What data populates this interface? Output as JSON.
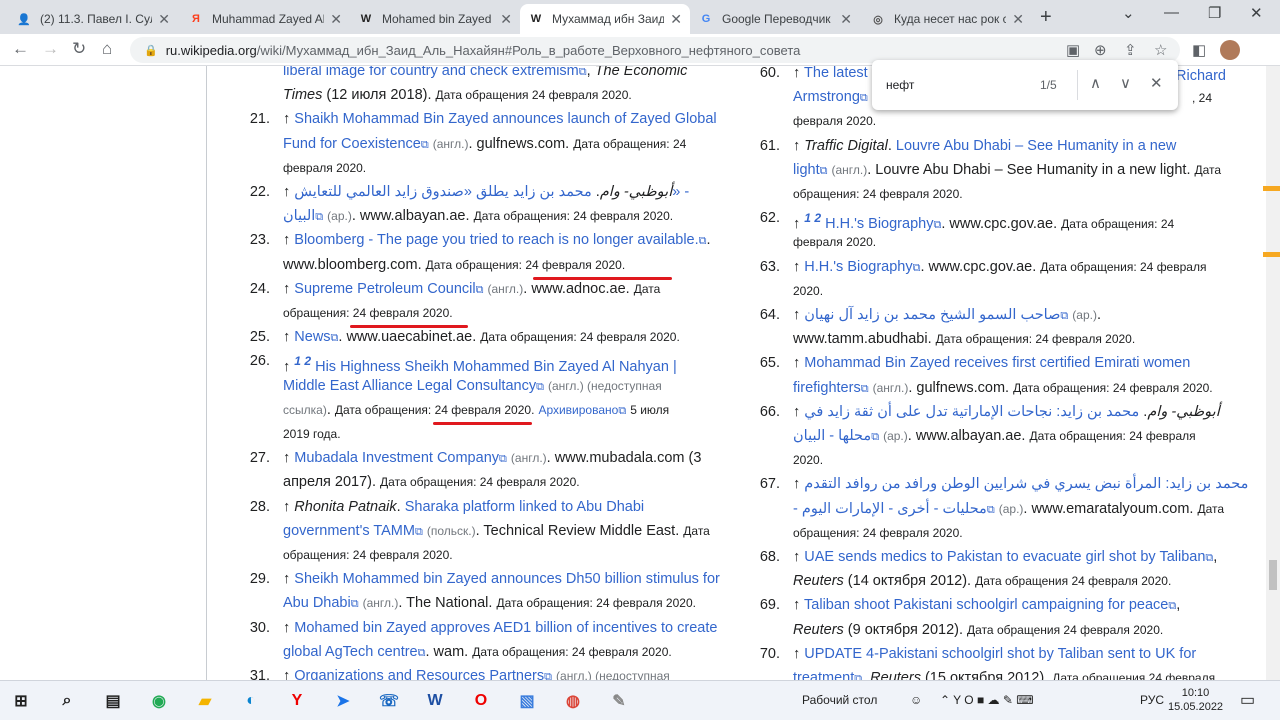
{
  "tabs": [
    {
      "title": "(2) 11.3. Павел І. Суле",
      "fav": "👤",
      "favcolor": "#6b4fa0"
    },
    {
      "title": "Muhammad Zayed Al",
      "fav": "Я",
      "favcolor": "#fc3f1d"
    },
    {
      "title": "Mohamed bin Zayed",
      "fav": "W",
      "favcolor": "#222"
    },
    {
      "title": "Мухаммад ибн Заид",
      "fav": "W",
      "favcolor": "#222"
    },
    {
      "title": "Google Переводчик",
      "fav": "G",
      "favcolor": "#4285f4"
    },
    {
      "title": "Куда несет нас рок с",
      "fav": "◎",
      "favcolor": "#555"
    }
  ],
  "url": {
    "host": "ru.wikipedia.org",
    "path": "/wiki/Мухаммад_ибн_Заид_Аль_Нахайян#Роль_в_работе_Верховного_нефтяного_совета"
  },
  "find": {
    "query": "нефт",
    "count": "1/5"
  },
  "left_refs": [
    {
      "n": "",
      "html": "<a>liberal image for country and check extremism</a><span class='ext'>⧉</span>, <i>The Economic</i>"
    },
    {
      "n": "",
      "html": "<i>Times</i> (12 июля 2018). <span class='meta'>Дата обращения 24 февраля 2020.</span>"
    },
    {
      "n": "21.",
      "html": "↑ <a>Shaikh Mohammad Bin Zayed announces launch of Zayed Global</a>"
    },
    {
      "n": "",
      "html": "<a>Fund for Coexistence</a><span class='ext'>⧉</span> <span class='lang'>(англ.)</span>. gulfnews.com. <span class='meta'>Дата обращения: 24</span>"
    },
    {
      "n": "",
      "html": "<span class='meta'>февраля 2020.</span>"
    },
    {
      "n": "22.",
      "html": "↑ <i>أبوظبي- وام</i>. <a>محمد بن زايد يطلق «صندوق زايد العالمي للتعايش» -</a>"
    },
    {
      "n": "",
      "html": "<a>البيان</a><span class='ext'>⧉</span> <span class='lang'>(ар.)</span>. www.albayan.ae. <span class='meta'>Дата обращения: 24 февраля 2020.</span>"
    },
    {
      "n": "23.",
      "html": "↑ <a>Bloomberg - The page you tried to reach is no longer available.</a><span class='ext'>⧉</span>."
    },
    {
      "n": "",
      "html": "www.bloomberg.com. <span class='meta'>Дата обращения: 24 февраля 2020.</span>"
    },
    {
      "n": "24.",
      "html": "↑ <a>Supreme Petroleum Council</a><span class='ext'>⧉</span> <span class='lang'>(англ.)</span>. www.adnoc.ae. <span class='meta'>Дата</span>"
    },
    {
      "n": "",
      "html": "<span class='meta'>обращения: 24 февраля 2020.</span>"
    },
    {
      "n": "25.",
      "html": "↑ <a>News</a><span class='ext'>⧉</span>. www.uaecabinet.ae. <span class='meta'>Дата обращения: 24 февраля 2020.</span>"
    },
    {
      "n": "26.",
      "html": "↑ <sup><a><b><i>1 2</i></b></a></sup> <a>His Highness Sheikh Mohammed Bin Zayed Al Nahyan |</a>"
    },
    {
      "n": "",
      "html": "<a>Middle East Alliance Legal Consultancy</a><span class='ext'>⧉</span> <span class='lang'>(англ.) (недоступная</span>"
    },
    {
      "n": "",
      "html": "<span class='lang'>ссылка)</span>. <span class='meta'>Дата обращения: 24 февраля 2020.</span> <a class='meta'>Архивировано</a><span class='ext'>⧉</span> <span class='meta'>5 июля</span>"
    },
    {
      "n": "",
      "html": "<span class='meta'>2019 года.</span>"
    },
    {
      "n": "27.",
      "html": "↑ <a>Mubadala Investment Company</a><span class='ext'>⧉</span> <span class='lang'>(англ.)</span>. www.mubadala.com (3"
    },
    {
      "n": "",
      "html": "апреля 2017). <span class='meta'>Дата обращения: 24 февраля 2020.</span>"
    },
    {
      "n": "28.",
      "html": "↑ <i>Rhonita Patnaik</i>. <a>Sharaka platform linked to Abu Dhabi</a>"
    },
    {
      "n": "",
      "html": "<a>government's TAMM</a><span class='ext'>⧉</span> <span class='lang'>(польск.)</span>. Technical Review Middle East. <span class='meta'>Дата</span>"
    },
    {
      "n": "",
      "html": "<span class='meta'>обращения: 24 февраля 2020.</span>"
    },
    {
      "n": "29.",
      "html": "↑ <a>Sheikh Mohammed bin Zayed announces Dh50 billion stimulus for</a>"
    },
    {
      "n": "",
      "html": "<a>Abu Dhabi</a><span class='ext'>⧉</span> <span class='lang'>(англ.)</span>. The National. <span class='meta'>Дата обращения: 24 февраля 2020.</span>"
    },
    {
      "n": "30.",
      "html": "↑ <a>Mohamed bin Zayed approves AED1 billion of incentives to create</a>"
    },
    {
      "n": "",
      "html": "<a>global AgTech centre</a><span class='ext'>⧉</span>. wam. <span class='meta'>Дата обращения: 24 февраля 2020.</span>"
    },
    {
      "n": "31.",
      "html": "↑ <a>Organizations and Resources Partners</a><span class='ext'>⧉</span> <span class='lang'>(англ.) (недоступная</span>"
    }
  ],
  "right_refs": [
    {
      "n": "60.",
      "html": "↑ <a>The latest</a>"
    },
    {
      "n": "",
      "html": "<a>Armstrong</a><span class='ext'>⧉</span>"
    },
    {
      "n": "",
      "html": "<span class='meta'>февраля 2020.</span>"
    },
    {
      "n": "61.",
      "html": "↑ <i>Traffic Digital</i>. <a>Louvre Abu Dhabi – See Humanity in a new</a>"
    },
    {
      "n": "",
      "html": "<a>light</a><span class='ext'>⧉</span> <span class='lang'>(англ.)</span>. Louvre Abu Dhabi – See Humanity in a new light. <span class='meta'>Дата</span>"
    },
    {
      "n": "",
      "html": "<span class='meta'>обращения: 24 февраля 2020.</span>"
    },
    {
      "n": "62.",
      "html": "↑ <sup><a><b><i>1 2</i></b></a></sup> <a>H.H.'s Biography</a><span class='ext'>⧉</span>. www.cpc.gov.ae. <span class='meta'>Дата обращения: 24</span>"
    },
    {
      "n": "",
      "html": "<span class='meta'>февраля 2020.</span>"
    },
    {
      "n": "63.",
      "html": "↑ <a>H.H.'s Biography</a><span class='ext'>⧉</span>. www.cpc.gov.ae. <span class='meta'>Дата обращения: 24 февраля</span>"
    },
    {
      "n": "",
      "html": "<span class='meta'>2020.</span>"
    },
    {
      "n": "64.",
      "html": "↑ <a>صاحب السمو الشيخ محمد بن زايد آل نهيان</a><span class='ext'>⧉</span> <span class='lang'>(ар.)</span>."
    },
    {
      "n": "",
      "html": "www.tamm.abudhabi. <span class='meta'>Дата обращения: 24 февраля 2020.</span>"
    },
    {
      "n": "65.",
      "html": "↑ <a>Mohammad Bin Zayed receives first certified Emirati women</a>"
    },
    {
      "n": "",
      "html": "<a>firefighters</a><span class='ext'>⧉</span> <span class='lang'>(англ.)</span>. gulfnews.com. <span class='meta'>Дата обращения: 24 февраля 2020.</span>"
    },
    {
      "n": "66.",
      "html": "↑ <i>أبوظبي- وام</i>. <a>محمد بن زايد: نجاحات الإماراتية تدل على أن ثقة زايد في</a>"
    },
    {
      "n": "",
      "html": "<a>محلها - البيان</a><span class='ext'>⧉</span> <span class='lang'>(ар.)</span>. www.albayan.ae. <span class='meta'>Дата обращения: 24 февраля</span>"
    },
    {
      "n": "",
      "html": "<span class='meta'>2020.</span>"
    },
    {
      "n": "67.",
      "html": "↑ <a>محمد بن زايد: المرأة نبض يسري في شرايين الوطن ورافد من روافد التقدم</a>"
    },
    {
      "n": "",
      "html": "<a>- محليات - أخرى - الإمارات اليوم</a><span class='ext'>⧉</span> <span class='lang'>(ар.)</span>. www.emaratalyoum.com. <span class='meta'>Дата</span>"
    },
    {
      "n": "",
      "html": "<span class='meta'>обращения: 24 февраля 2020.</span>"
    },
    {
      "n": "68.",
      "html": "↑ <a>UAE sends medics to Pakistan to evacuate girl shot by Taliban</a><span class='ext'>⧉</span>,"
    },
    {
      "n": "",
      "html": "<i>Reuters</i> (14 октября 2012). <span class='meta'>Дата обращения 24 февраля 2020.</span>"
    },
    {
      "n": "69.",
      "html": "↑ <a>Taliban shoot Pakistani schoolgirl campaigning for peace</a><span class='ext'>⧉</span>,"
    },
    {
      "n": "",
      "html": "<i>Reuters</i> (9 октября 2012). <span class='meta'>Дата обращения 24 февраля 2020.</span>"
    },
    {
      "n": "70.",
      "html": "↑ <a>UPDATE 4-Pakistani schoolgirl shot by Taliban sent to UK for</a>"
    },
    {
      "n": "",
      "html": "<a>treatment</a><span class='ext'>⧉</span>, <i>Reuters</i> (15 октября 2012). <span class='meta'>Дата обращения 24 февраля</span>"
    }
  ],
  "right_partial": {
    "r1": "Richard",
    "r2": ", 24"
  },
  "taskbar": {
    "desktop_label": "Рабочий стол",
    "lang": "РУС",
    "time": "10:10",
    "date": "15.05.2022"
  }
}
